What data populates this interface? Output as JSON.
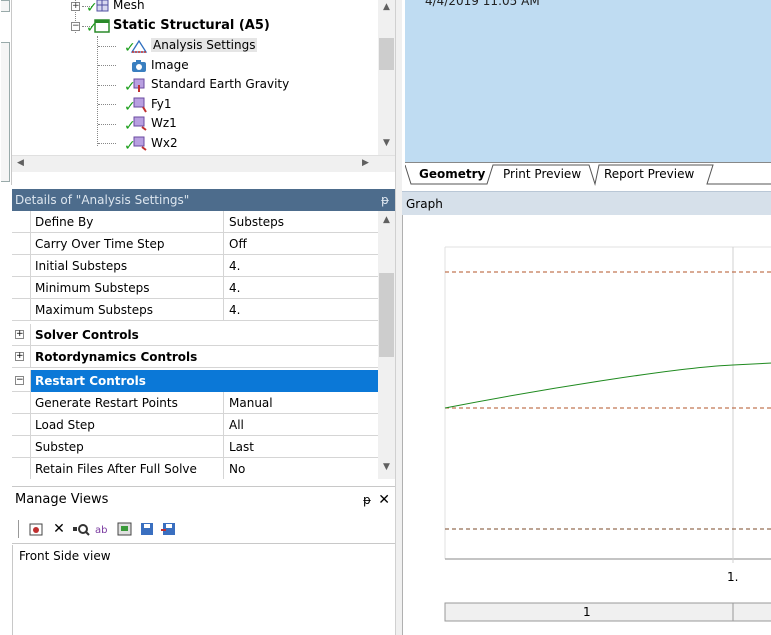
{
  "tree": {
    "items": [
      {
        "label": "Mesh"
      },
      {
        "label": "Static Structural (A5)"
      },
      {
        "label": "Analysis Settings"
      },
      {
        "label": "Image"
      },
      {
        "label": "Standard Earth Gravity"
      },
      {
        "label": "Fy1"
      },
      {
        "label": "Wz1"
      },
      {
        "label": "Wx2"
      }
    ]
  },
  "details": {
    "title": "Details of \"Analysis Settings\"",
    "pin": "ᵽ",
    "rows": [
      {
        "key": "Define By",
        "value": "Substeps"
      },
      {
        "key": "Carry Over Time Step",
        "value": "Off"
      },
      {
        "key": "Initial Substeps",
        "value": "4."
      },
      {
        "key": "Minimum Substeps",
        "value": "4."
      },
      {
        "key": "Maximum Substeps",
        "value": "4."
      }
    ],
    "groups": {
      "solver": "Solver Controls",
      "rotor": "Rotordynamics Controls",
      "restart": "Restart Controls"
    },
    "restart_rows": [
      {
        "key": "Generate Restart Points",
        "value": "Manual"
      },
      {
        "key": "Load Step",
        "value": "All"
      },
      {
        "key": "Substep",
        "value": "Last"
      },
      {
        "key": "Retain Files After Full Solve",
        "value": "No"
      }
    ]
  },
  "manage_views": {
    "title": "Manage Views",
    "pin": "ᵽ",
    "close": "✕",
    "items": [
      "Front Side view"
    ]
  },
  "viewport": {
    "timestamp": "4/4/2019 11:05 AM",
    "tabs": [
      "Geometry",
      "Print Preview",
      "Report Preview"
    ]
  },
  "graph": {
    "title": "Graph",
    "x_tick": "1.",
    "table_cell": "1"
  },
  "colors": {
    "accent": "#0b78d7",
    "details_header": "#4d6c8c",
    "viewport_bg": "#bfdcf2",
    "curve": "#1f8a1f",
    "limit_line": "#b3542a"
  }
}
